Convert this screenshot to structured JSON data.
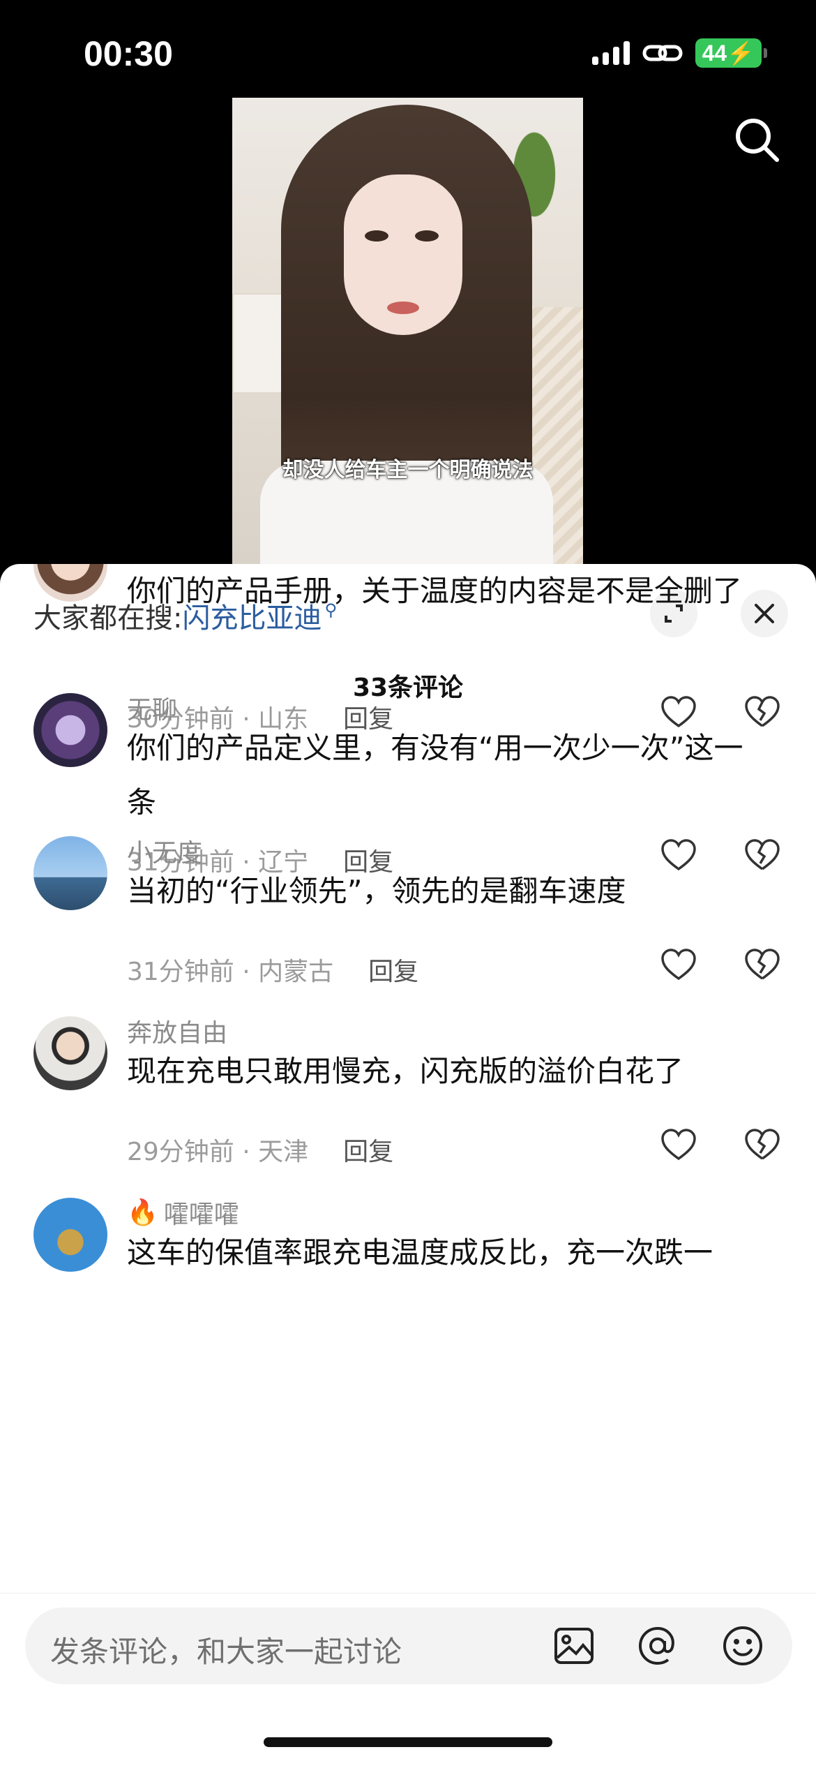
{
  "status": {
    "time": "00:30",
    "battery": "44"
  },
  "video": {
    "caption": "却没人给车主一个明确说法"
  },
  "sheet": {
    "hot_prefix": "大家都在搜:",
    "hot_keyword": "闪充比亚迪",
    "count_title": "33条评论"
  },
  "comments": [
    {
      "name": "",
      "text": "你们的产品手册，关于温度的内容是不是全删了",
      "time_loc": "30分钟前 · 山东",
      "reply": "回复"
    },
    {
      "name": "无聊",
      "text": "你们的产品定义里，有没有“用一次少一次”这一条",
      "time_loc": "31分钟前 · 辽宁",
      "reply": "回复"
    },
    {
      "name": "小无度",
      "text": "当初的“行业领先”，领先的是翻车速度",
      "time_loc": "31分钟前 · 内蒙古",
      "reply": "回复"
    },
    {
      "name": "奔放自由",
      "text": "现在充电只敢用慢充，闪充版的溢价白花了",
      "time_loc": "29分钟前 · 天津",
      "reply": "回复"
    },
    {
      "name": "嚯嚯嚯",
      "text": "这车的保值率跟充电温度成反比，充一次跌一",
      "time_loc": "",
      "reply": ""
    }
  ],
  "input": {
    "placeholder": "发条评论，和大家一起讨论"
  },
  "icons": [
    "search-icon",
    "expand-icon",
    "close-icon",
    "heart-icon",
    "broken-heart-icon",
    "image-icon",
    "at-icon",
    "emoji-icon",
    "fire-icon"
  ]
}
